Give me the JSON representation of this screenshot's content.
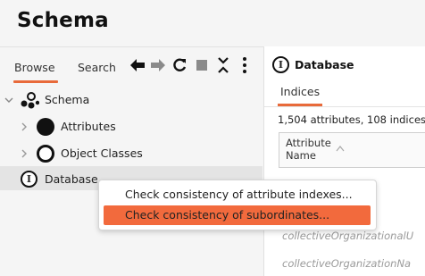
{
  "app": {
    "title": "Schema"
  },
  "left_panel": {
    "tabs": [
      {
        "label": "Browse"
      },
      {
        "label": "Search"
      }
    ],
    "toolbar": [
      {
        "icon": "back-arrow-icon",
        "glyph": "🡸"
      },
      {
        "icon": "forward-arrow-icon",
        "glyph": "🡺"
      },
      {
        "icon": "refresh-icon",
        "glyph": "↻"
      },
      {
        "icon": "stop-icon",
        "glyph": "■"
      },
      {
        "icon": "collapse-icon",
        "glyph": "⨯"
      },
      {
        "icon": "more-vertical-icon",
        "glyph": "⋮"
      }
    ],
    "tree": {
      "root": {
        "label": "Schema",
        "icon": "schema-icon"
      },
      "items": [
        {
          "label": "Attributes",
          "icon": "attribute-dot-icon"
        },
        {
          "label": "Object Classes",
          "icon": "object-class-ring-icon"
        },
        {
          "label": "Database",
          "icon": "database-info-icon"
        }
      ]
    }
  },
  "context_menu": {
    "items": [
      {
        "label": "Check consistency of attribute indexes...",
        "selected": false
      },
      {
        "label": "Check consistency of subordinates...",
        "selected": true
      }
    ]
  },
  "right_panel": {
    "title": "Database",
    "tabs": [
      {
        "label": "Indices"
      }
    ],
    "summary": "1,504 attributes, 108 indices",
    "table": {
      "column": "Attribute Name",
      "rows": [
        "collectiveOrganizationalU",
        "collectiveOrganizationNa"
      ]
    }
  },
  "colors": {
    "accent": "#e86a3a",
    "selection": "#f26a3d",
    "panel_bg": "#f5f5f5"
  }
}
